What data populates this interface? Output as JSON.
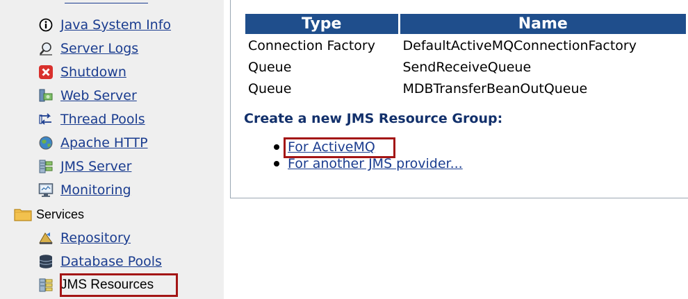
{
  "sidebar": {
    "items": [
      {
        "label": "Java System Info",
        "icon": "info-icon"
      },
      {
        "label": "Server Logs",
        "icon": "search-icon"
      },
      {
        "label": "Shutdown",
        "icon": "shutdown-icon"
      },
      {
        "label": "Web Server",
        "icon": "web-server-icon"
      },
      {
        "label": "Thread Pools",
        "icon": "thread-pools-icon"
      },
      {
        "label": "Apache HTTP",
        "icon": "globe-icon"
      },
      {
        "label": "JMS Server",
        "icon": "jms-server-icon"
      },
      {
        "label": "Monitoring",
        "icon": "monitor-icon"
      }
    ],
    "services_folder": {
      "label": "Services",
      "icon": "folder-icon"
    },
    "service_items": [
      {
        "label": "Repository",
        "icon": "repository-icon"
      },
      {
        "label": "Database Pools",
        "icon": "database-icon"
      },
      {
        "label": "JMS Resources",
        "icon": "jms-resources-icon",
        "selected": true
      }
    ]
  },
  "main": {
    "table": {
      "headers": [
        "Type",
        "Name"
      ],
      "rows": [
        [
          "Connection Factory",
          "DefaultActiveMQConnectionFactory"
        ],
        [
          "Queue",
          "SendReceiveQueue"
        ],
        [
          "Queue",
          "MDBTransferBeanOutQueue"
        ]
      ]
    },
    "create_heading": "Create a new JMS Resource Group:",
    "providers": [
      {
        "label": "For ActiveMQ",
        "highlighted": true
      },
      {
        "label": "For another JMS provider..."
      }
    ]
  },
  "colors": {
    "header_bg": "#1f4e8c",
    "link": "#1a3c8f",
    "highlight": "#a31515",
    "sidebar_bg": "#efefef"
  }
}
